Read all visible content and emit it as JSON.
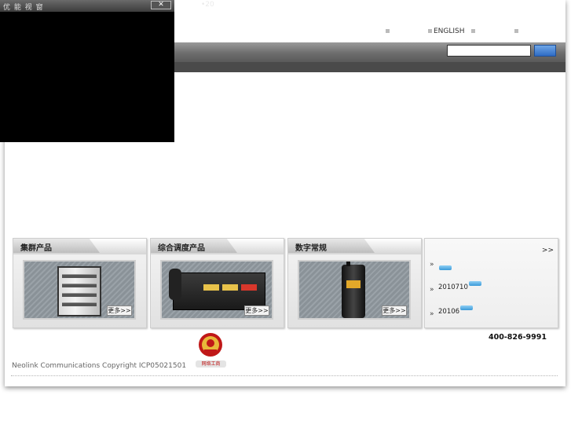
{
  "top_links": [
    "",
    "ENGLISH",
    "",
    ""
  ],
  "nav": {
    "items": [
      "",
      "",
      "",
      "",
      ""
    ],
    "search_placeholder": "",
    "search_button": ""
  },
  "sub_nav": [
    "",
    "•20"
  ],
  "popup": {
    "title": "优 能 视 窗",
    "close_label": "✕"
  },
  "products": [
    {
      "title": "集群产品",
      "more": "更多>>"
    },
    {
      "title": "综合调度产品",
      "more": "更多>>"
    },
    {
      "title": "数字常规",
      "more": "更多>>"
    }
  ],
  "news": {
    "title": "",
    "more": ">>",
    "items": [
      {
        "text": ""
      },
      {
        "text": "2010710"
      },
      {
        "text": "20106"
      }
    ]
  },
  "footer": {
    "hotline": "400-826-9991",
    "copyright": "Neolink Communications Copyright ICP05021501",
    "badge_label": "网络工商"
  },
  "colors": {
    "nav_bar": "#6d6d6d",
    "search_button": "#2f6cc4",
    "badge_red": "#c01818"
  }
}
